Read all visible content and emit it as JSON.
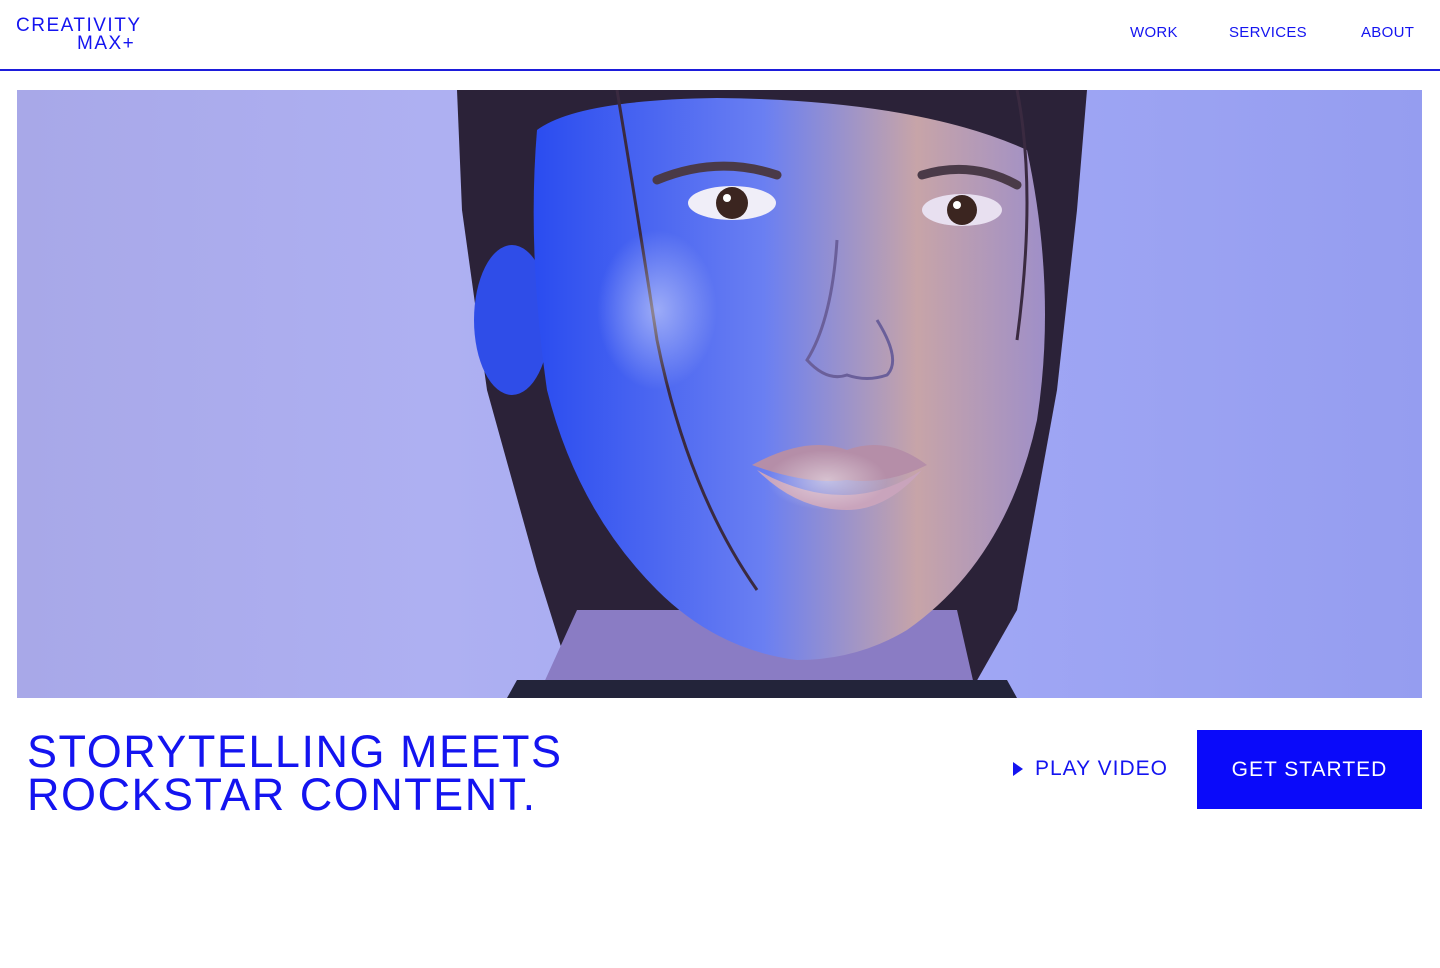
{
  "header": {
    "logo_line1": "CREATIVITY",
    "logo_line2": "MAX+",
    "nav": {
      "work": "WORK",
      "services": "SERVICES",
      "about": "ABOUT"
    }
  },
  "hero": {
    "image_subject": "portrait-photo"
  },
  "cta": {
    "headline_line1": "STORYTELLING MEETS",
    "headline_line2": "ROCKSTAR CONTENT.",
    "play_video": "PLAY VIDEO",
    "get_started": "GET STARTED"
  },
  "colors": {
    "accent": "#1414f0",
    "button_bg": "#0a0afa",
    "hero_bg": "#a8aaf0"
  },
  "icons": {
    "play": "play-icon"
  }
}
